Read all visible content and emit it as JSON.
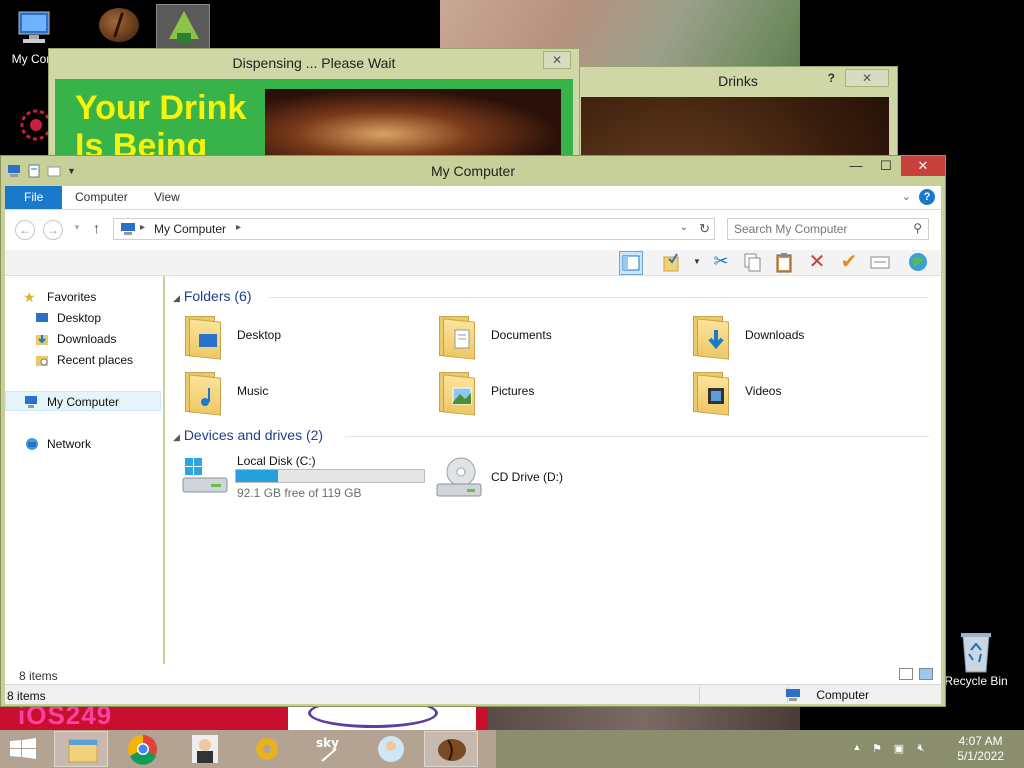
{
  "desktop": {
    "my_computer_label": "My Com",
    "recycle_bin_label": "Recycle Bin",
    "bottom_left_text": "iOS249"
  },
  "dispensing_window": {
    "title": "Dispensing ... Please Wait",
    "headline_line1": "Your Drink",
    "headline_line2": "Is Being"
  },
  "drinks_window": {
    "title": "Drinks",
    "help": "?"
  },
  "explorer": {
    "title": "My Computer",
    "tabs": {
      "file": "File",
      "computer": "Computer",
      "view": "View"
    },
    "address": {
      "location": "My Computer"
    },
    "search": {
      "placeholder": "Search My Computer"
    },
    "nav": {
      "favorites": "Favorites",
      "desktop": "Desktop",
      "downloads": "Downloads",
      "recent": "Recent places",
      "my_computer": "My Computer",
      "network": "Network"
    },
    "folders_header": "Folders (6)",
    "folders": [
      {
        "name": "Desktop"
      },
      {
        "name": "Documents"
      },
      {
        "name": "Downloads"
      },
      {
        "name": "Music"
      },
      {
        "name": "Pictures"
      },
      {
        "name": "Videos"
      }
    ],
    "devices_header": "Devices and drives (2)",
    "drives": [
      {
        "name": "Local Disk (C:)",
        "free_text": "92.1 GB free of 119 GB",
        "used_fraction": 0.226
      },
      {
        "name": "CD Drive (D:)"
      }
    ],
    "status_inner": {
      "count": "8 items"
    },
    "status_outer": {
      "count": "8 items",
      "location": "Computer"
    }
  },
  "taskbar": {
    "time": "4:07 AM",
    "date": "5/1/2022"
  },
  "colors": {
    "file_tab": "#1979ca",
    "close_button": "#c7403b",
    "window_frame": "#c8d09a",
    "drive_fill": "#26a0da",
    "dispensing_bg": "#38b34a",
    "headline_text": "#f8f30a"
  }
}
